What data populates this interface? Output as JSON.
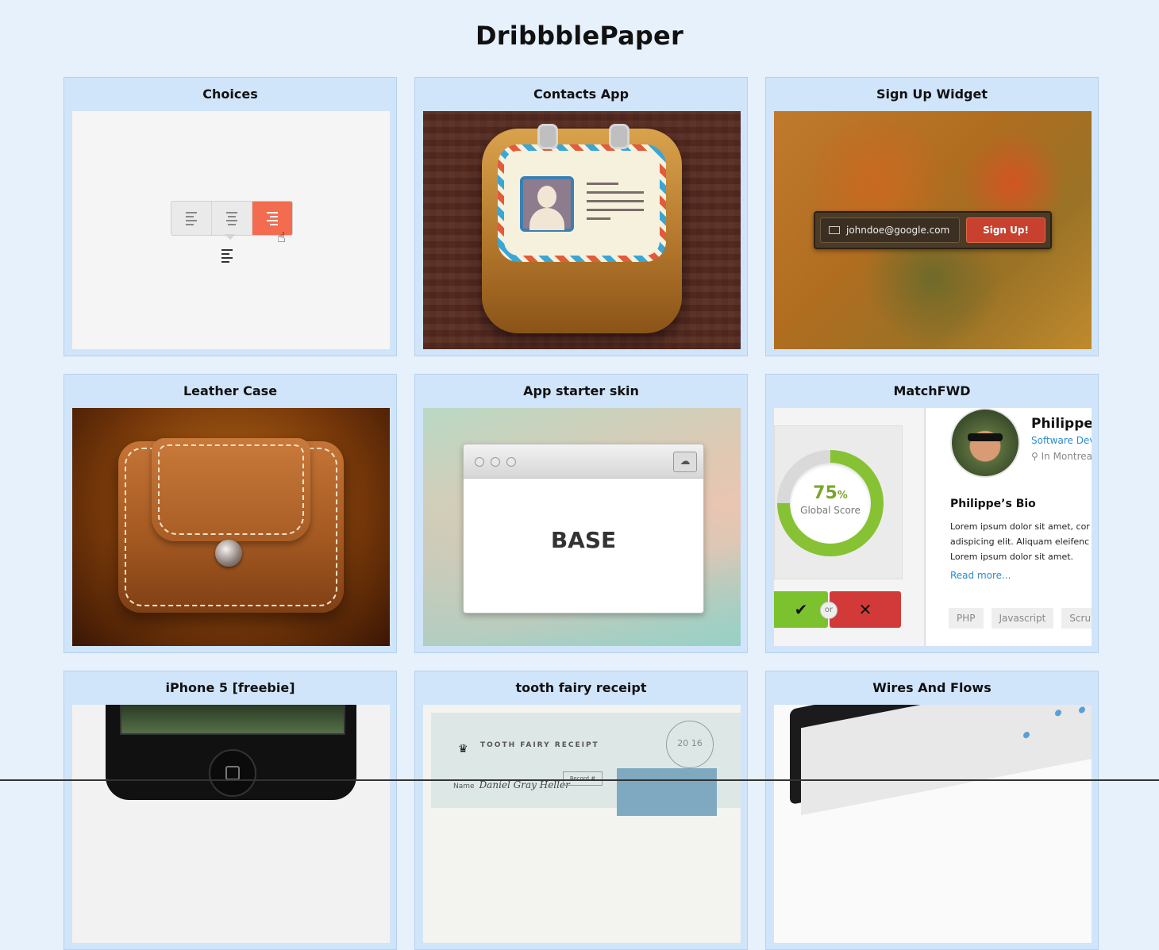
{
  "site": {
    "title": "DribbblePaper"
  },
  "cards": [
    {
      "title": "Choices"
    },
    {
      "title": "Contacts App"
    },
    {
      "title": "Sign Up Widget",
      "email": "johndoe@google.com",
      "button": "Sign Up!"
    },
    {
      "title": "Leather Case"
    },
    {
      "title": "App starter skin",
      "label": "BASE"
    },
    {
      "title": "MatchFWD",
      "score": "75",
      "score_unit": "%",
      "score_label": "Global Score",
      "or_label": "or",
      "name": "Philippe (",
      "role": "Software Dev",
      "location": "In Montrea",
      "bio_heading": "Philippe’s Bio",
      "bio_text": "Lorem ipsum dolor sit amet, cor adispicing elit. Aliquam eleifenc Lorem ipsum dolor sit amet.",
      "read_more": "Read more...",
      "tags": [
        "PHP",
        "Javascript",
        "Scrun"
      ]
    },
    {
      "title": "iPhone 5 [freebie]"
    },
    {
      "title": "tooth fairy receipt",
      "heading": "TOOTH FAIRY RECEIPT",
      "name_label": "Name",
      "signature": "Daniel Gray Heller",
      "record_label": "Record #",
      "stamp": "20 16"
    },
    {
      "title": "Wires And Flows"
    }
  ],
  "colors": {
    "page_bg": "#e6f1fb",
    "card_bg": "#d0e5fa",
    "accent": "#f36c4f"
  }
}
